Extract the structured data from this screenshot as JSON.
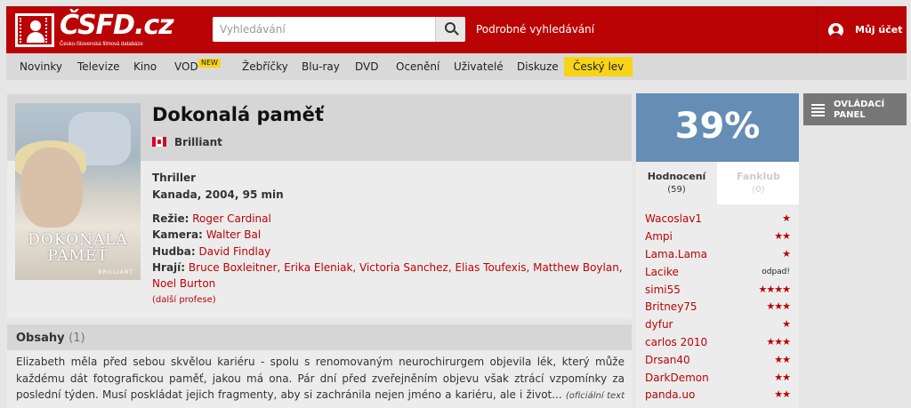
{
  "header": {
    "logo_text": "ČSFD.cz",
    "logo_sub": "Česko-Slovenská filmová databáze",
    "search_placeholder": "Vyhledávání",
    "advanced_search": "Podrobné vyhledávání",
    "account": "Můj účet"
  },
  "nav": {
    "items": [
      "Novinky",
      "Televize",
      "Kino",
      "VOD",
      "Žebříčky",
      "Blu-ray",
      "DVD",
      "Ocenění",
      "Uživatelé",
      "Diskuze",
      "Český lev"
    ],
    "new_badge": "NEW"
  },
  "film": {
    "title": "Dokonalá paměť",
    "alt_name": "Brilliant",
    "genre": "Thriller",
    "origin": "Kanada, 2004, 95 min",
    "credits": {
      "rezie_label": "Režie:",
      "rezie": "Roger Cardinal",
      "kamera_label": "Kamera:",
      "kamera": "Walter Bal",
      "hudba_label": "Hudba:",
      "hudba": "David Findlay",
      "hraji_label": "Hrají:",
      "hraji": "Bruce Boxleitner, Erika Eleniak, Victoria Sanchez, Elias Toufexis, Matthew Boylan, Noel Burton"
    },
    "more_professions": "(další profese)",
    "poster": {
      "title_line1": "DOKONALÁ",
      "title_line2": "PAMĚŤ",
      "brand": "BRILLIANT"
    }
  },
  "plot": {
    "title": "Obsahy",
    "count": "(1)",
    "text": "Elizabeth měla před sebou skvělou kariéru - spolu s renomovaným neurochirurgem objevila lék, který může každému dát fotografickou paměť, jakou má ona. Pár dní před zveřejněním objevu však ztrácí vzpomínky za poslední týden. Musí poskládat jejich fragmenty, aby si zachránila nejen jméno a kariéru, ale i život...",
    "source": "(oficiální text distributora)"
  },
  "rating": {
    "value": "39%",
    "tab_ratings": "Hodnocení",
    "tab_ratings_count": "(59)",
    "tab_fanclub": "Fanklub",
    "tab_fanclub_count": "(0)"
  },
  "ratings_list": [
    {
      "user": "Wacoslav1",
      "stars": "★"
    },
    {
      "user": "Ampi",
      "stars": "★★"
    },
    {
      "user": "Lama.Lama",
      "stars": "★"
    },
    {
      "user": "Lacike",
      "stars": "odpad!"
    },
    {
      "user": "simi55",
      "stars": "★★★★"
    },
    {
      "user": "Britney75",
      "stars": "★★★"
    },
    {
      "user": "dyfur",
      "stars": "★"
    },
    {
      "user": "carlos 2010",
      "stars": "★★★"
    },
    {
      "user": "Drsan40",
      "stars": "★★"
    },
    {
      "user": "DarkDemon",
      "stars": "★★"
    },
    {
      "user": "panda.uo",
      "stars": "★★"
    }
  ],
  "control_panel": {
    "line1": "OVLÁDACÍ",
    "line2": "PANEL"
  }
}
